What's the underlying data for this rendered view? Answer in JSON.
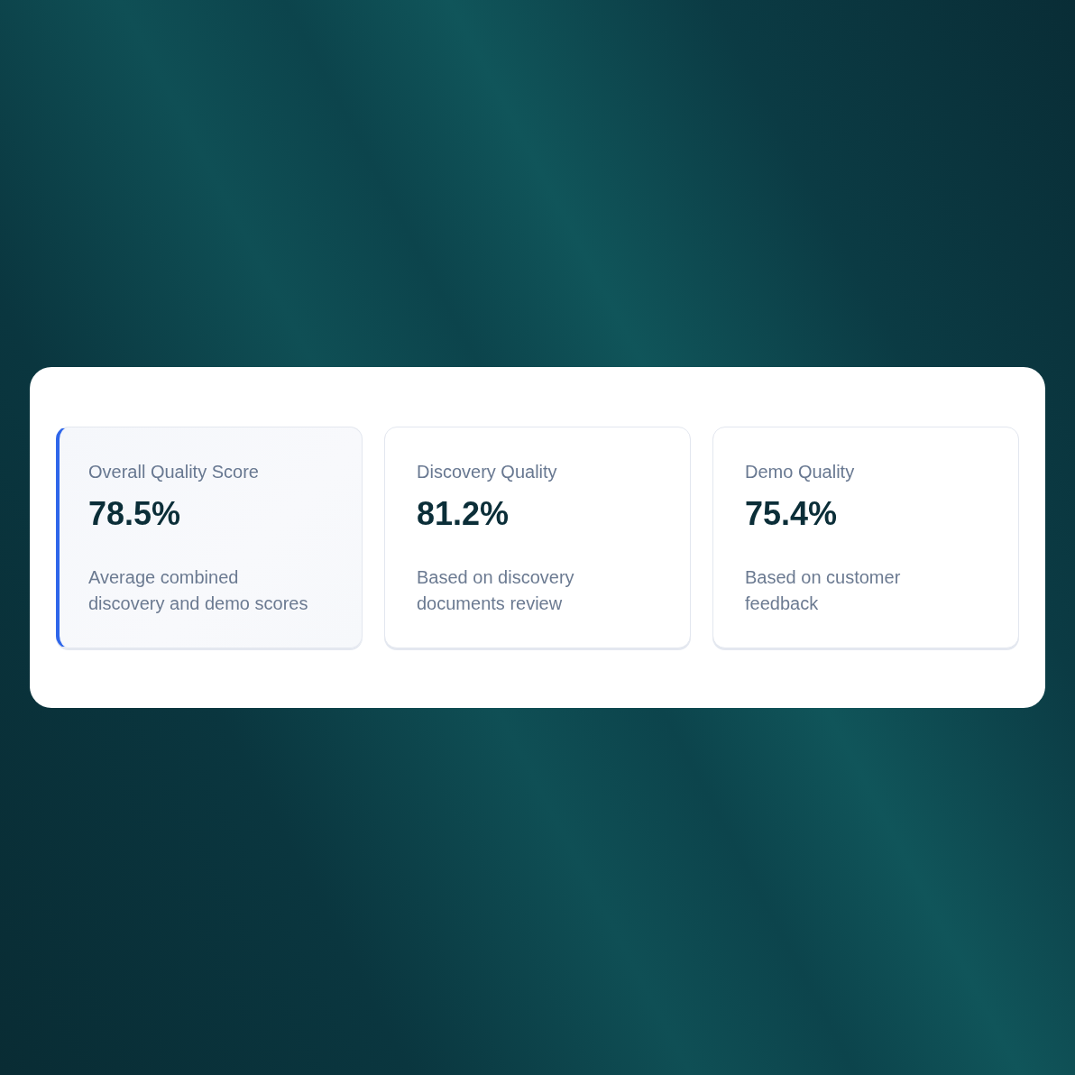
{
  "cards": [
    {
      "label": "Overall Quality Score",
      "value": "78.5%",
      "description": "Average combined discovery and demo scores",
      "selected": true
    },
    {
      "label": "Discovery Quality",
      "value": "81.2%",
      "description": "Based on discovery documents review",
      "selected": false
    },
    {
      "label": "Demo Quality",
      "value": "75.4%",
      "description": "Based on customer feedback",
      "selected": false
    }
  ]
}
